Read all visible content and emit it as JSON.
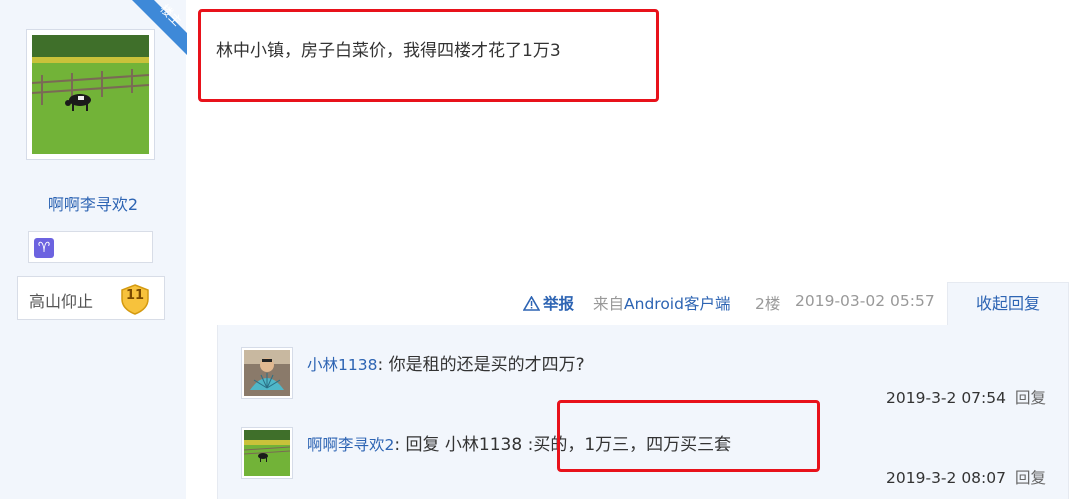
{
  "author": {
    "name": "啊啊李寻欢2",
    "aries_symbol": "♈",
    "level_title": "高山仰止",
    "level_number": "11",
    "op_badge": "楼主"
  },
  "post": {
    "content": "林中小镇，房子白菜价，我得四楼才花了1万3",
    "report_label": "举报",
    "from_prefix": "来自",
    "client_name": "Android客户端",
    "floor": "2楼",
    "time": "2019-03-02 05:57",
    "collapse_label": "收起回复"
  },
  "replies": [
    {
      "user": "小林1138",
      "separator": ": ",
      "text": "你是租的还是买的才四万?",
      "time": "2019-3-2 07:54",
      "reply_label": "回复"
    },
    {
      "user": "啊啊李寻欢2",
      "separator": ": ",
      "text": "回复 小林1138 :买的，1万三，四万买三套",
      "time": "2019-3-2 08:07",
      "reply_label": "回复"
    }
  ],
  "colors": {
    "link_blue": "#2d64b3",
    "annotation_red": "#e8121b",
    "sidebar_bg": "#f2f6fc"
  }
}
